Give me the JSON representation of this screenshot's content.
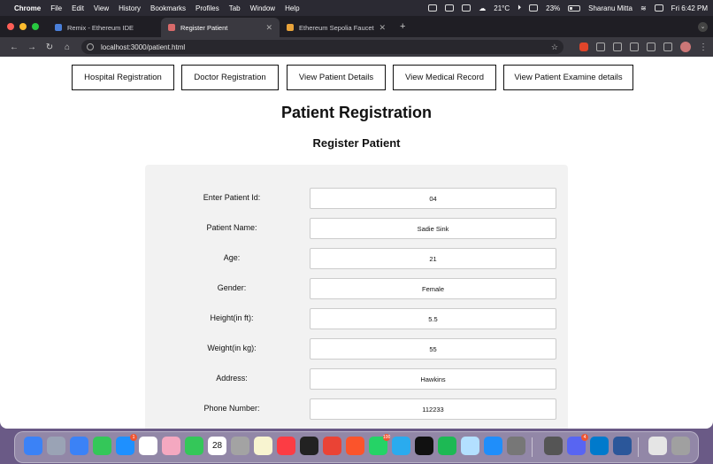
{
  "menubar": {
    "app": "Chrome",
    "items": [
      "File",
      "Edit",
      "View",
      "History",
      "Bookmarks",
      "Profiles",
      "Tab",
      "Window",
      "Help"
    ],
    "weather": "21°C",
    "battery": "23%",
    "user": "Sharanu Mitta",
    "datetime": "Fri 6:42 PM"
  },
  "tabs": [
    {
      "label": "Remix - Ethereum IDE",
      "favicon_color": "#4a7fd9",
      "active": false
    },
    {
      "label": "Register Patient",
      "favicon_color": "#d86a6a",
      "active": true
    },
    {
      "label": "Ethereum Sepolia Faucet",
      "favicon_color": "#e8a33a",
      "active": false
    }
  ],
  "toolbar": {
    "url": "localhost:3000/patient.html",
    "extension_badge": "3"
  },
  "nav": {
    "buttons": [
      "Hospital Registration",
      "Doctor Registration",
      "View Patient Details",
      "View Medical Record",
      "View Patient Examine details"
    ]
  },
  "page": {
    "title": "Patient Registration",
    "subtitle": "Register Patient"
  },
  "form": {
    "fields": [
      {
        "label": "Enter Patient Id:",
        "value": "04"
      },
      {
        "label": "Patient Name:",
        "value": "Sadie Sink"
      },
      {
        "label": "Age:",
        "value": "21"
      },
      {
        "label": "Gender:",
        "value": "Female"
      },
      {
        "label": "Height(in ft):",
        "value": "5.5"
      },
      {
        "label": "Weight(in kg):",
        "value": "55"
      },
      {
        "label": "Address:",
        "value": "Hawkins"
      },
      {
        "label": "Phone Number:",
        "value": "112233"
      }
    ]
  },
  "dock": {
    "calendar_day": "28",
    "mail_badge": "1",
    "whatsapp_badge": "100",
    "discord_badge": "4",
    "colors": [
      "#3b82f6",
      "#9aa3b5",
      "#3b82f6",
      "#34c759",
      "#1e90ff",
      "#ffffff",
      "#f4a8c0",
      "#34c759",
      "#ffffff",
      "#a3a3a3",
      "#f8f4d0",
      "#fc3c44",
      "#222222",
      "#ea4335",
      "#fb542b",
      "#25d366",
      "#2aabee",
      "#111111",
      "#1db954",
      "#b3e0ff",
      "#1f8efa",
      "#777777",
      "#555555",
      "#5865f2",
      "#007acc",
      "#2b579a",
      "#e5e5e5",
      "#a0a0a0"
    ]
  }
}
